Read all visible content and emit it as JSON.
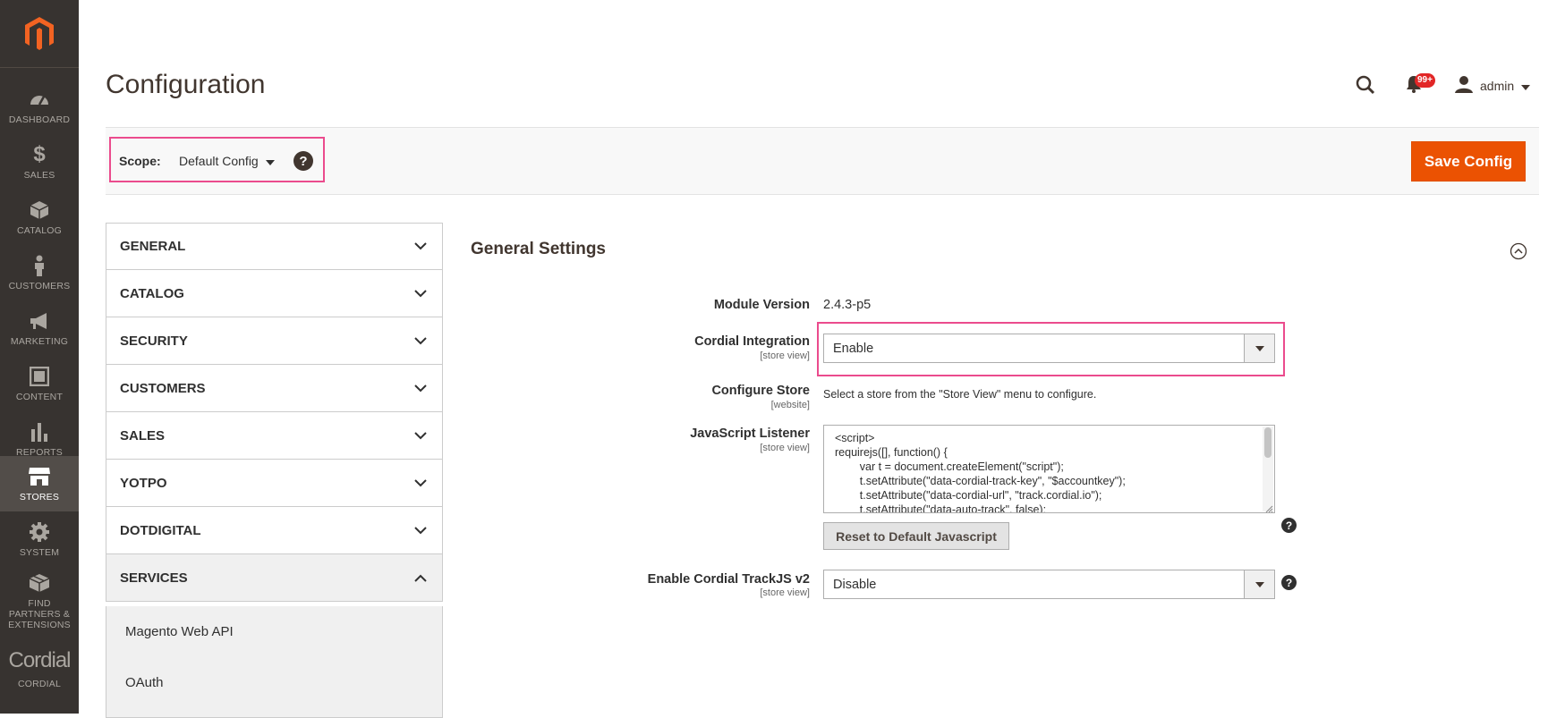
{
  "nav": {
    "items": [
      {
        "label": "DASHBOARD",
        "icon": "dashboard-icon"
      },
      {
        "label": "SALES",
        "icon": "dollar-icon"
      },
      {
        "label": "CATALOG",
        "icon": "box-icon"
      },
      {
        "label": "CUSTOMERS",
        "icon": "person-icon"
      },
      {
        "label": "MARKETING",
        "icon": "megaphone-icon"
      },
      {
        "label": "CONTENT",
        "icon": "layout-icon"
      },
      {
        "label": "REPORTS",
        "icon": "bar-chart-icon"
      },
      {
        "label": "STORES",
        "icon": "store-icon"
      },
      {
        "label": "SYSTEM",
        "icon": "gear-icon"
      },
      {
        "label": "FIND PARTNERS & EXTENSIONS",
        "icon": "extensions-icon"
      },
      {
        "label": "CORDIAL",
        "icon": "cordial-logo",
        "logo_text": "Cordial"
      }
    ]
  },
  "header": {
    "title": "Configuration",
    "notification_count": "99+",
    "user": "admin"
  },
  "scope": {
    "label": "Scope:",
    "value": "Default Config",
    "help": "?",
    "save_label": "Save Config"
  },
  "tabs": [
    {
      "label": "GENERAL"
    },
    {
      "label": "CATALOG"
    },
    {
      "label": "SECURITY"
    },
    {
      "label": "CUSTOMERS"
    },
    {
      "label": "SALES"
    },
    {
      "label": "YOTPO"
    },
    {
      "label": "DOTDIGITAL"
    },
    {
      "label": "SERVICES"
    }
  ],
  "services_items": [
    "Magento Web API",
    "OAuth"
  ],
  "section": {
    "title": "General Settings",
    "module_version_label": "Module Version",
    "module_version_value": "2.4.3-p5",
    "integration_label": "Cordial Integration",
    "integration_scope": "[store view]",
    "integration_value": "Enable",
    "configure_store_label": "Configure Store",
    "configure_store_scope": "[website]",
    "configure_store_note": "Select a store from the \"Store View\" menu to configure.",
    "js_listener_label": "JavaScript Listener",
    "js_listener_scope": "[store view]",
    "js_listener_code": "<script>\nrequirejs([], function() {\n        var t = document.createElement(\"script\");\n        t.setAttribute(\"data-cordial-track-key\", \"$accountkey\");\n        t.setAttribute(\"data-cordial-url\", \"track.cordial.io\");\n        t.setAttribute(\"data-auto-track\", false);",
    "reset_label": "Reset to Default Javascript",
    "trackjs_label": "Enable Cordial TrackJS v2",
    "trackjs_scope": "[store view]",
    "trackjs_value": "Disable",
    "help": "?"
  },
  "colors": {
    "nav_bg": "#373330",
    "accent": "#eb5202",
    "highlight": "#eb4b8d",
    "logo": "#f26322"
  }
}
